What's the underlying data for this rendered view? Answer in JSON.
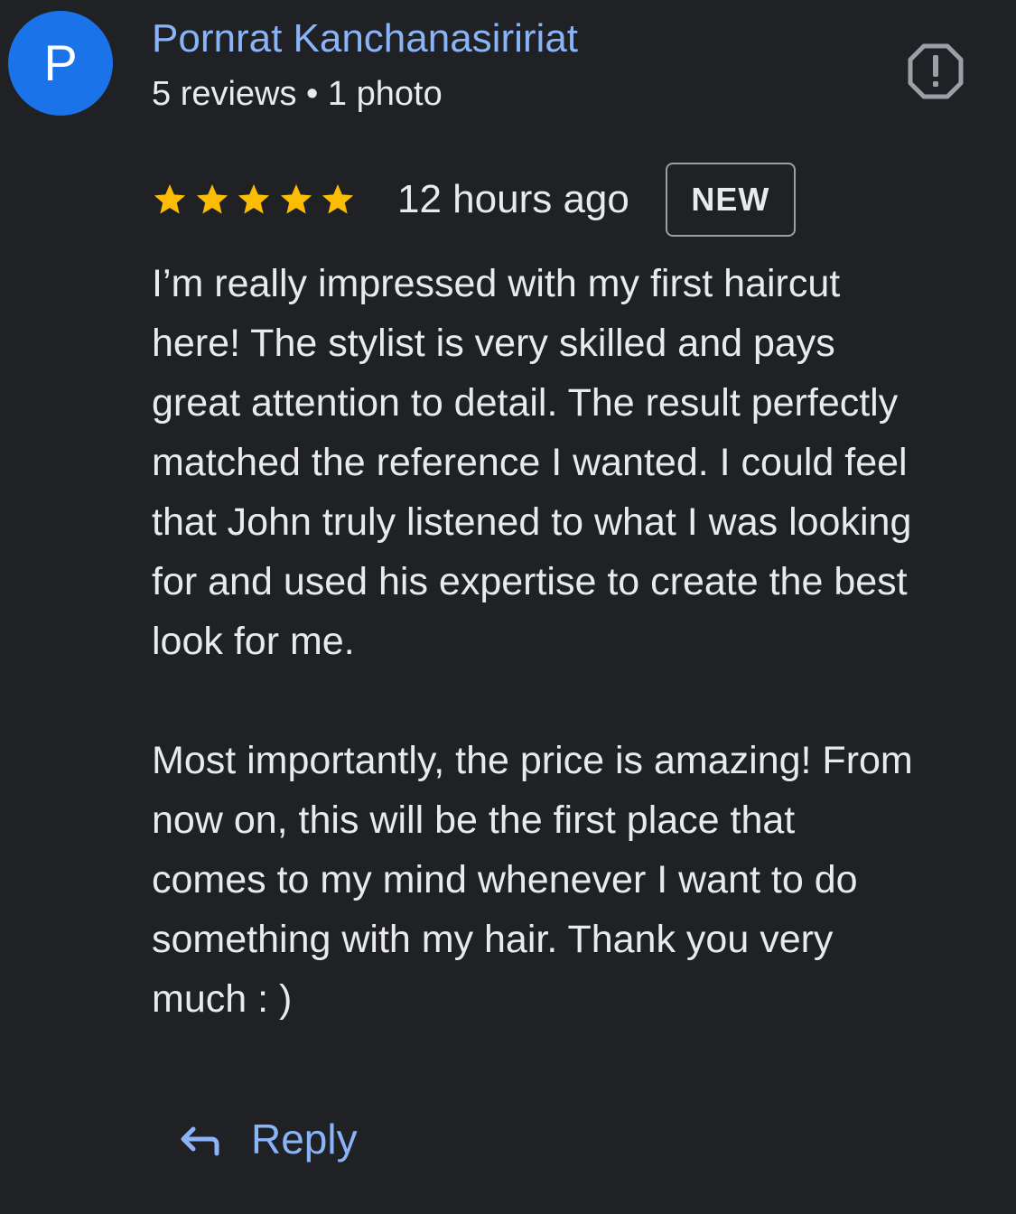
{
  "review": {
    "author": {
      "initial": "P",
      "name": "Pornrat Kanchanasiririat",
      "meta": "5 reviews • 1 photo"
    },
    "rating": 5,
    "stars": [
      "star-filled-icon",
      "star-filled-icon",
      "star-filled-icon",
      "star-filled-icon",
      "star-filled-icon"
    ],
    "timestamp": "12 hours ago",
    "badge": "NEW",
    "report_icon": "report-flag-icon",
    "paragraphs": [
      "I’m really impressed with my first haircut\nhere! The stylist is very skilled and pays\ngreat attention to detail. The result perfectly\nmatched the reference I wanted. I could feel\nthat John truly listened to what I was looking\nfor and used his expertise to create the best\nlook for me.",
      "Most importantly, the price is amazing! From\nnow on, this will be the first place that\ncomes to my mind whenever I want to do\nsomething with my hair. Thank you very\nmuch : )"
    ],
    "reply": {
      "label": "Reply",
      "icon": "reply-arrow-icon"
    }
  },
  "colors": {
    "background": "#202124",
    "text": "#e8eaed",
    "link": "#8ab4f8",
    "avatar": "#1a73e8",
    "star": "#fbbc04",
    "icon": "#9aa0a6"
  }
}
